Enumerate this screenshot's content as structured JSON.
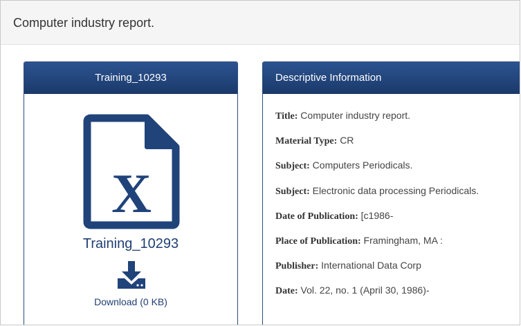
{
  "header": {
    "title": "Computer industry report."
  },
  "file_panel": {
    "heading": "Training_10293",
    "icon": "file-excel-icon",
    "file_name": "Training_10293",
    "download_icon": "download-icon",
    "download_label": "Download (0 KB)"
  },
  "info_panel": {
    "heading": "Descriptive Information",
    "fields": [
      {
        "label": "Title:",
        "value": "Computer industry report."
      },
      {
        "label": "Material Type:",
        "value": "CR"
      },
      {
        "label": "Subject:",
        "value": "Computers Periodicals."
      },
      {
        "label": "Subject:",
        "value": "Electronic data processing Periodicals."
      },
      {
        "label": "Date of Publication:",
        "value": "[c1986-"
      },
      {
        "label": "Place of Publication:",
        "value": "Framingham, MA :"
      },
      {
        "label": "Publisher:",
        "value": "International Data Corp"
      },
      {
        "label": "Date:",
        "value": "Vol. 22, no. 1 (April 30, 1986)-"
      }
    ]
  },
  "colors": {
    "panel_header": "#20437a",
    "accent": "#1f3f73",
    "page_header_bg": "#f5f5f5"
  }
}
